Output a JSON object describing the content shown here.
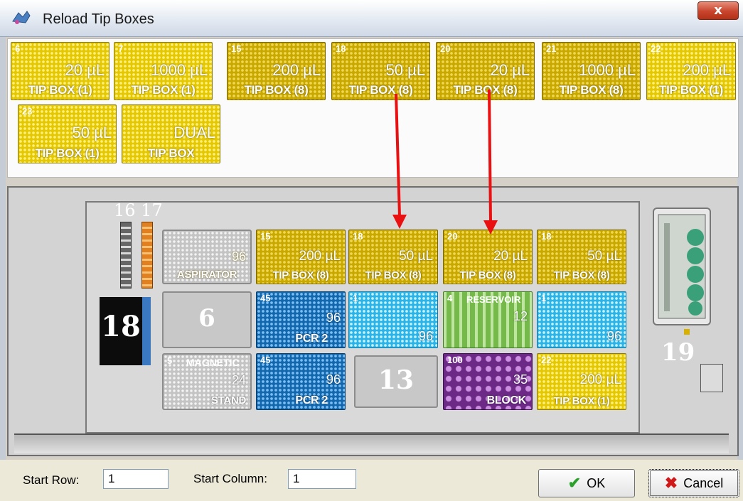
{
  "window": {
    "title": "Reload Tip Boxes",
    "close_glyph": "x"
  },
  "tray_boxes": [
    {
      "pos": "6",
      "vol": "20 µL",
      "name": "TIP BOX (1)"
    },
    {
      "pos": "7",
      "vol": "1000 µL",
      "name": "TIP BOX (1)"
    },
    {
      "pos": "15",
      "vol": "200 µL",
      "name": "TIP BOX (8)"
    },
    {
      "pos": "18",
      "vol": "50 µL",
      "name": "TIP BOX (8)"
    },
    {
      "pos": "20",
      "vol": "20 µL",
      "name": "TIP BOX (8)"
    },
    {
      "pos": "21",
      "vol": "1000 µL",
      "name": "TIP BOX (8)"
    },
    {
      "pos": "22",
      "vol": "200 µL",
      "name": "TIP BOX (1)"
    },
    {
      "pos": "23",
      "vol": "50 µL",
      "name": "TIP BOX (1)"
    },
    {
      "pos": "",
      "vol": "DUAL",
      "name": "TIP BOX"
    }
  ],
  "deck": {
    "labels": {
      "slots_16_17": "16 17",
      "slot_18": "18",
      "slot_19": "19"
    },
    "row1": [
      {
        "pos": "",
        "vol": "96",
        "name": "ASPIRATOR"
      },
      {
        "pos": "15",
        "vol": "200 µL",
        "name": "TIP BOX (8)"
      },
      {
        "pos": "18",
        "vol": "50 µL",
        "name": "TIP BOX (8)"
      },
      {
        "pos": "20",
        "vol": "20 µL",
        "name": "TIP BOX (8)"
      },
      {
        "pos": "18",
        "vol": "50 µL",
        "name": "TIP BOX (8)"
      }
    ],
    "row2": [
      {
        "label": "6"
      },
      {
        "pos": "45",
        "vol": "96",
        "name": "PCR 2"
      },
      {
        "pos": "1",
        "vol": "96"
      },
      {
        "pos": "4",
        "title": "RESERVOIR",
        "vol": "12"
      },
      {
        "pos": "1",
        "vol": "96"
      }
    ],
    "row3": [
      {
        "pos": "5",
        "title": "MAGNETIC",
        "vol": "24",
        "name": "STAND"
      },
      {
        "pos": "45",
        "vol": "96",
        "name": "PCR 2"
      },
      {
        "label": "13"
      },
      {
        "pos": "100",
        "vol": "35",
        "name": "BLOCK"
      },
      {
        "pos": "22",
        "vol": "200 µL",
        "name": "TIP BOX (1)"
      }
    ]
  },
  "footer": {
    "start_row_label": "Start Row:",
    "start_row_value": "1",
    "start_col_label": "Start Column:",
    "start_col_value": "1",
    "ok_label": "OK",
    "cancel_label": "Cancel"
  },
  "colors": {
    "arrow": "#e81010",
    "tip_yellow": "#e5c800",
    "tip_gold": "#c9a800",
    "pcr_blue": "#1367ad",
    "plate_cyan": "#2bb4e8",
    "reservoir_green": "#74b94a",
    "block_purple": "#6c2a86"
  }
}
